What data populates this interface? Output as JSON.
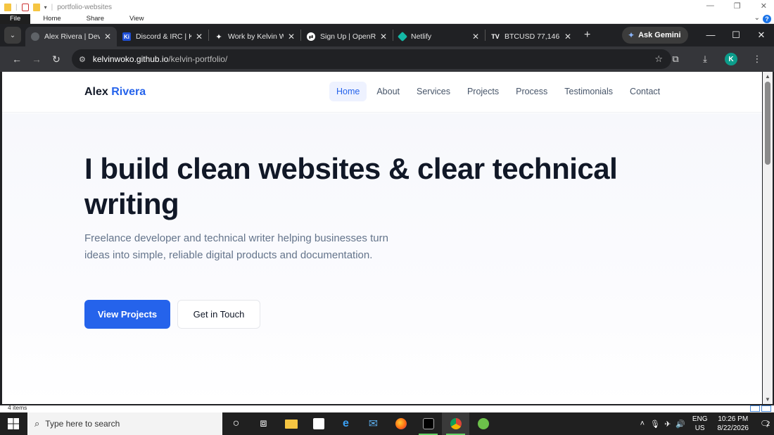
{
  "explorer": {
    "title": "portfolio-websites",
    "menu": [
      "File",
      "Home",
      "Share",
      "View"
    ],
    "status_text": "4 items"
  },
  "browser": {
    "tabs": [
      {
        "title": "Alex Rivera | Dev",
        "active": true,
        "favicon": "globe-icon"
      },
      {
        "title": "Discord & IRC | K",
        "active": false,
        "favicon": "ki-icon"
      },
      {
        "title": "Work by Kelvin W",
        "active": false,
        "favicon": "compass-icon"
      },
      {
        "title": "Sign Up | OpenR",
        "active": false,
        "favicon": "openrouter-icon"
      },
      {
        "title": "Netlify",
        "active": false,
        "favicon": "netlify-icon"
      },
      {
        "title": "BTCUSD 77,146",
        "active": false,
        "favicon": "tradingview-icon"
      }
    ],
    "gemini_label": "Ask Gemini",
    "url_host": "kelvinwoko.github.io",
    "url_path": "/kelvin-portfolio/",
    "profile_initial": "K"
  },
  "site": {
    "brand_first": "Alex",
    "brand_last": "Rivera",
    "nav": [
      "Home",
      "About",
      "Services",
      "Projects",
      "Process",
      "Testimonials",
      "Contact"
    ],
    "active_nav": "Home",
    "hero_title": "I build clean websites & clear technical writing",
    "hero_sub": "Freelance developer and technical writer helping businesses turn ideas into simple, reliable digital products and documentation.",
    "primary_cta": "View Projects",
    "secondary_cta": "Get in Touch",
    "accent": "#2563eb"
  },
  "taskbar": {
    "search_placeholder": "Type here to search",
    "lang_top": "ENG",
    "lang_bottom": "US",
    "time": "10:26 PM",
    "date": "8/22/2026",
    "notifications": "2"
  }
}
